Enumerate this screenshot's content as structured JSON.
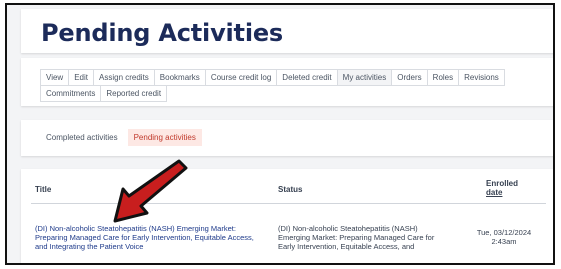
{
  "page": {
    "title": "Pending Activities"
  },
  "tabs": [
    {
      "label": "View"
    },
    {
      "label": "Edit"
    },
    {
      "label": "Assign credits"
    },
    {
      "label": "Bookmarks"
    },
    {
      "label": "Course credit log"
    },
    {
      "label": "Deleted credit"
    },
    {
      "label": "My activities",
      "active": true
    },
    {
      "label": "Orders"
    },
    {
      "label": "Roles"
    },
    {
      "label": "Revisions"
    },
    {
      "label": "Commitments"
    },
    {
      "label": "Reported credit"
    }
  ],
  "subtabs": [
    {
      "label": "Completed activities"
    },
    {
      "label": "Pending activities",
      "active": true
    }
  ],
  "table": {
    "headers": {
      "title": "Title",
      "status": "Status",
      "enrolled": "Enrolled",
      "date": "date"
    },
    "rows": [
      {
        "title": "(DI) Non-alcoholic Steatohepatitis (NASH) Emerging Market: Preparing Managed Care for Early Intervention, Equitable Access, and Integrating the Patient Voice",
        "status": "(DI) Non-alcoholic Steatohepatitis (NASH) Emerging Market: Preparing Managed Care for Early Intervention, Equitable Access, and",
        "enrolled_date": "Tue, 03/12/2024",
        "enrolled_time": "2:43am"
      }
    ]
  },
  "colors": {
    "title": "#1c2b5a",
    "link": "#1e3a8a",
    "active_subtab_bg": "#fde8e4",
    "active_subtab_text": "#c0392b",
    "arrow": "#c81e1e",
    "frame_border": "#111111"
  },
  "annotation": {
    "icon": "red-arrow-pointing-icon"
  }
}
